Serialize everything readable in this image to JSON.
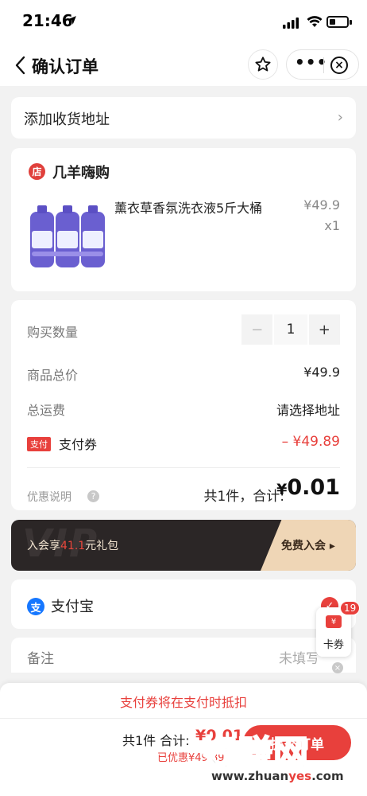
{
  "status": {
    "time": "21:46"
  },
  "nav": {
    "title": "确认订单",
    "more": "•••"
  },
  "address": {
    "label": "添加收货地址",
    "arrow": "›"
  },
  "shop": {
    "icon_text": "店",
    "name": "几羊嗨购",
    "product": {
      "title": "薰衣草香氛洗衣液5斤大桶",
      "price": "¥49.9",
      "qty": "x1"
    }
  },
  "summary": {
    "qty_label": "购买数量",
    "qty_minus": "−",
    "qty_value": "1",
    "qty_plus": "+",
    "total_label": "商品总价",
    "total_value": "¥49.9",
    "freight_label": "总运费",
    "freight_value": "请选择地址",
    "coupon_tag": "支付",
    "coupon_label": "支付券",
    "coupon_value": "– ¥49.89",
    "promo_label": "优惠说明",
    "help": "?",
    "sum_text": "共1件，合计:",
    "sum_yen": "¥",
    "sum_value": "0.01"
  },
  "vip": {
    "bg_text": "VIP",
    "text_pre": "入会享",
    "text_hl": "41.1",
    "text_post": "元礼包",
    "join": "免费入会 ▸"
  },
  "payment": {
    "icon_text": "支",
    "label": "支付宝",
    "check": "✓"
  },
  "note": {
    "label": "备注",
    "value": "未填写"
  },
  "card_coupon": {
    "ticket": "¥",
    "label": "卡券",
    "badge": "19",
    "close": "×"
  },
  "notice": "支付券将在支付时抵扣",
  "bottom": {
    "total_text": "共1件 合计:",
    "total_value": "¥0.01",
    "saved_text": "已优惠¥49.89",
    "submit": "提交订单"
  },
  "watermark": {
    "text": "好赚网",
    "url_pre": "www.zhuan",
    "url_hl": "yes",
    "url_post": ".com"
  },
  "colors": {
    "accent": "#e8403c",
    "alipay": "#1677ff",
    "vip_dark": "#2b2626",
    "vip_gold": "#efd6b6"
  }
}
